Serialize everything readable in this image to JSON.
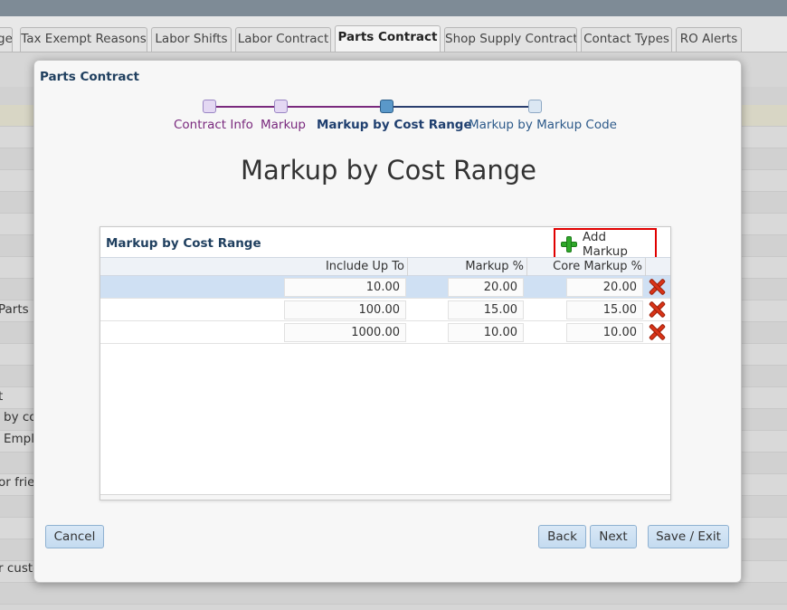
{
  "tabs": [
    {
      "label": "ge"
    },
    {
      "label": "Tax Exempt Reasons"
    },
    {
      "label": "Labor Shifts"
    },
    {
      "label": "Labor Contract"
    },
    {
      "label": "Parts Contract",
      "active": true
    },
    {
      "label": "Shop Supply Contract"
    },
    {
      "label": "Contact Types"
    },
    {
      "label": "RO Alerts"
    }
  ],
  "background_labels": [
    "Parts",
    "t",
    "by co",
    "Emplo",
    "or frier",
    "r custo"
  ],
  "dialog": {
    "title": "Parts Contract",
    "train": [
      {
        "label": "Contract Info",
        "state": "visited"
      },
      {
        "label": "Markup",
        "state": "visited"
      },
      {
        "label": "Markup by Cost Range",
        "state": "current"
      },
      {
        "label": "Markup by Markup Code",
        "state": "future"
      }
    ],
    "heading": "Markup by Cost Range",
    "panel": {
      "title": "Markup by Cost Range",
      "add_label": "Add Markup",
      "columns": [
        "Include Up To",
        "Markup %",
        "Core Markup %"
      ],
      "rows": [
        {
          "include_up_to": "10.00",
          "markup": "20.00",
          "core_markup": "20.00",
          "selected": true
        },
        {
          "include_up_to": "100.00",
          "markup": "15.00",
          "core_markup": "15.00"
        },
        {
          "include_up_to": "1000.00",
          "markup": "10.00",
          "core_markup": "10.00"
        }
      ]
    },
    "buttons": {
      "cancel": "Cancel",
      "back": "Back",
      "next": "Next",
      "save_exit": "Save / Exit"
    }
  },
  "colors": {
    "highlight_border": "#e00000",
    "add_icon": "#2fa82a",
    "delete_icon": "#d93418",
    "selected_row": "#cfe0f3"
  }
}
